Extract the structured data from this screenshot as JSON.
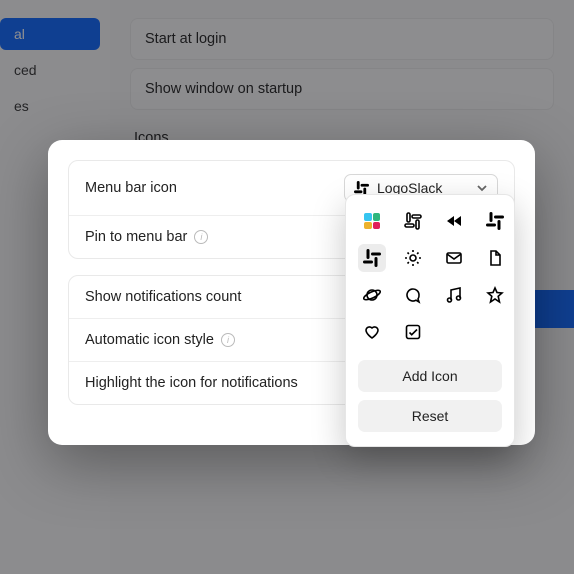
{
  "sidebar": {
    "items": [
      {
        "label": "al",
        "active": true
      },
      {
        "label": "ced",
        "active": false
      },
      {
        "label": "es",
        "active": false
      }
    ]
  },
  "background": {
    "rows": [
      "Start at login",
      "Show window on startup"
    ],
    "section_header": "Icons"
  },
  "modal": {
    "panel1": {
      "menu_bar_icon_label": "Menu bar icon",
      "selected_icon_label": "LogoSlack",
      "pin_label": "Pin to menu bar"
    },
    "panel2": {
      "show_notif_label": "Show notifications count",
      "auto_icon_label": "Automatic icon style",
      "highlight_label": "Highlight the icon for notifications"
    }
  },
  "dropdown": {
    "icons": [
      "slack-color-icon",
      "slack-outline-icon",
      "rewind-icon",
      "slack-hash-icon",
      "slack-black-icon",
      "gear-icon",
      "mail-icon",
      "document-icon",
      "planet-icon",
      "chat-icon",
      "music-icon",
      "star-icon",
      "heart-icon",
      "checkbox-icon"
    ],
    "selected_index": 4,
    "add_icon_label": "Add Icon",
    "reset_label": "Reset"
  }
}
